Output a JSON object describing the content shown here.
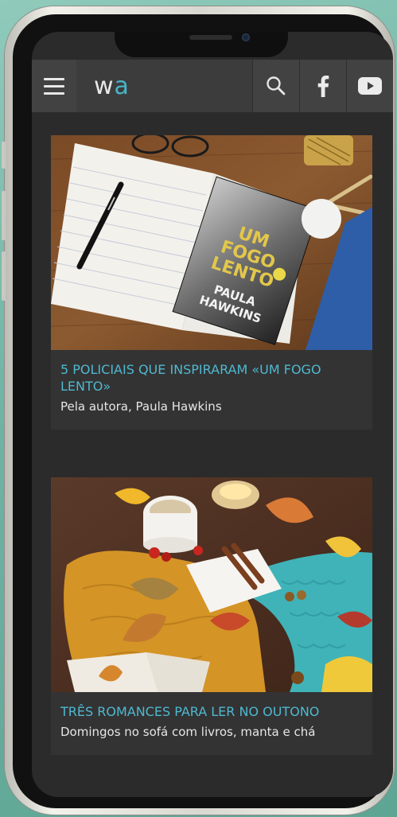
{
  "header": {
    "logo_main": "w",
    "logo_accent": "a"
  },
  "icons": {
    "menu": "menu-icon",
    "search": "search-icon",
    "facebook": "facebook-icon",
    "youtube": "youtube-icon"
  },
  "colors": {
    "accent": "#4fb8d0",
    "topbar": "#3c3c3c",
    "card": "#333333"
  },
  "articles": [
    {
      "title": "5 POLICIAIS QUE INSPIRARAM «UM FOGO LENTO»",
      "subtitle": "Pela autora, Paula Hawkins",
      "book_title": "UM FOGO LENTO",
      "book_author": "PAULA HAWKINS"
    },
    {
      "title": "TRÊS ROMANCES PARA LER NO OUTONO",
      "subtitle": "Domingos no sofá com livros, manta e chá"
    }
  ]
}
